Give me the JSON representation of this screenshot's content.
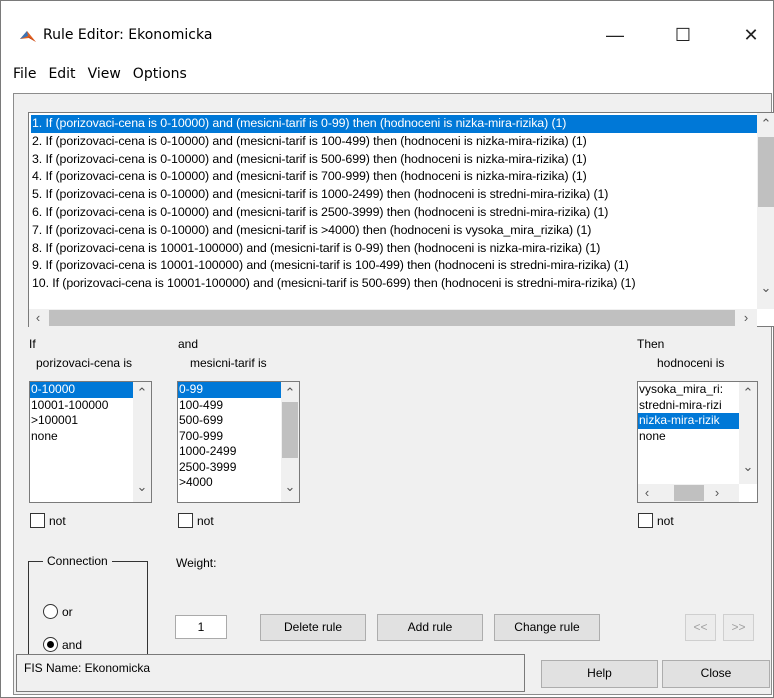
{
  "window": {
    "title": "Rule Editor: Ekonomicka",
    "controls": {
      "minimize": "—",
      "maximize": "☐",
      "close": "✕"
    }
  },
  "menu": [
    "File",
    "Edit",
    "View",
    "Options"
  ],
  "rules": [
    "1. If (porizovaci-cena is 0-10000) and (mesicni-tarif is 0-99) then (hodnoceni is nizka-mira-rizika) (1)",
    "2. If (porizovaci-cena is 0-10000) and (mesicni-tarif is 100-499) then (hodnoceni is nizka-mira-rizika) (1)",
    "3. If (porizovaci-cena is 0-10000) and (mesicni-tarif is 500-699) then (hodnoceni is nizka-mira-rizika) (1)",
    "4. If (porizovaci-cena is 0-10000) and (mesicni-tarif is 700-999) then (hodnoceni is nizka-mira-rizika) (1)",
    "5. If (porizovaci-cena is 0-10000) and (mesicni-tarif is 1000-2499) then (hodnoceni is stredni-mira-rizika) (1)",
    "6. If (porizovaci-cena is 0-10000) and (mesicni-tarif is 2500-3999) then (hodnoceni is stredni-mira-rizika) (1)",
    "7. If (porizovaci-cena is 0-10000) and (mesicni-tarif is >4000) then (hodnoceni is vysoka_mira_rizika) (1)",
    "8. If (porizovaci-cena is 10001-100000) and (mesicni-tarif is 0-99) then (hodnoceni is nizka-mira-rizika) (1)",
    "9. If (porizovaci-cena is 10001-100000) and (mesicni-tarif is 100-499) then (hodnoceni is stredni-mira-rizika) (1)",
    "10. If (porizovaci-cena is 10001-100000) and (mesicni-tarif is 500-699) then (hodnoceni is stredni-mira-rizika) (1)"
  ],
  "selected_rule_index": 0,
  "if_section": {
    "header": "If",
    "label": "porizovaci-cena is",
    "options": [
      "0-10000",
      "10001-100000",
      ">100001",
      "none"
    ],
    "selected": 0,
    "not_label": "not"
  },
  "and_section": {
    "header": "and",
    "label": "mesicni-tarif is",
    "options": [
      "0-99",
      "100-499",
      "500-699",
      "700-999",
      "1000-2499",
      "2500-3999",
      ">4000"
    ],
    "selected": 0,
    "not_label": "not"
  },
  "then_section": {
    "header": "Then",
    "label": "hodnoceni is",
    "options": [
      "vysoka_mira_ri:",
      "stredni-mira-rizi",
      "nizka-mira-rizik",
      "none"
    ],
    "selected": 2,
    "not_label": "not"
  },
  "connection": {
    "title": "Connection",
    "options": [
      "or",
      "and"
    ],
    "selected": 1
  },
  "weight": {
    "label": "Weight:",
    "value": "1"
  },
  "buttons": {
    "delete_rule": "Delete rule",
    "add_rule": "Add rule",
    "change_rule": "Change rule",
    "prev": "<<",
    "next": ">>",
    "help": "Help",
    "close": "Close"
  },
  "status": "FIS Name: Ekonomicka",
  "colors": {
    "selection": "#0078d7",
    "panel": "#f0f0f0"
  }
}
